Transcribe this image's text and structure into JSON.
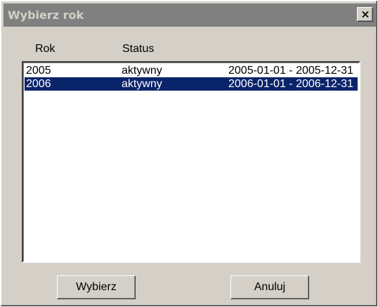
{
  "window": {
    "title": "Wybierz rok",
    "close_icon": "close-icon"
  },
  "list": {
    "columns": [
      "Rok",
      "Status"
    ],
    "rows": [
      {
        "rok": "2005",
        "status": "aktywny",
        "period": "2005-01-01 - 2005-12-31",
        "selected": false
      },
      {
        "rok": "2006",
        "status": "aktywny",
        "period": "2006-01-01 - 2006-12-31",
        "selected": true
      }
    ]
  },
  "buttons": {
    "select_label": "Wybierz",
    "cancel_label": "Anuluj"
  },
  "colors": {
    "dialog_bg": "#d4d0c8",
    "titlebar_inactive": "#808080",
    "selection_bg": "#0a246a",
    "selection_text": "#ffffff"
  }
}
